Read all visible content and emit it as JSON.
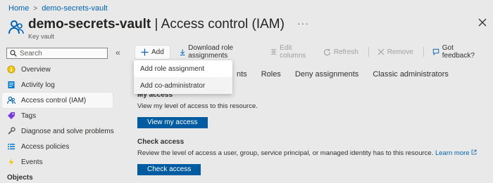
{
  "breadcrumb": {
    "home": "Home",
    "current": "demo-secrets-vault"
  },
  "header": {
    "resource_name": "demo-secrets-vault",
    "page_name": "| Access control (IAM)",
    "subtitle": "Key vault",
    "more": "···"
  },
  "search": {
    "placeholder": "Search"
  },
  "collapse": "«",
  "nav": {
    "items": [
      {
        "label": "Overview",
        "icon": "overview-icon"
      },
      {
        "label": "Activity log",
        "icon": "activity-log-icon"
      },
      {
        "label": "Access control (IAM)",
        "icon": "people-icon",
        "active": true
      },
      {
        "label": "Tags",
        "icon": "tag-icon"
      },
      {
        "label": "Diagnose and solve problems",
        "icon": "wrench-icon"
      },
      {
        "label": "Access policies",
        "icon": "list-icon"
      },
      {
        "label": "Events",
        "icon": "lightning-icon"
      }
    ],
    "section_heading": "Objects"
  },
  "toolbar": {
    "add": "Add",
    "download": "Download role assignments",
    "edit_columns": "Edit columns",
    "refresh": "Refresh",
    "remove": "Remove",
    "feedback": "Got feedback?"
  },
  "dropdown": {
    "items": [
      "Add role assignment",
      "Add co-administrator"
    ]
  },
  "tabs": [
    "nts",
    "Roles",
    "Deny assignments",
    "Classic administrators"
  ],
  "my_access": {
    "title": "My access",
    "text": "View my level of access to this resource.",
    "button": "View my access"
  },
  "check_access": {
    "title": "Check access",
    "text": "Review the level of access a user, group, service principal, or managed identity has to this resource.",
    "link": "Learn more",
    "button": "Check access"
  },
  "colors": {
    "accent": "#005ba1",
    "link": "#0063b1",
    "background": "#e9e9e9"
  }
}
